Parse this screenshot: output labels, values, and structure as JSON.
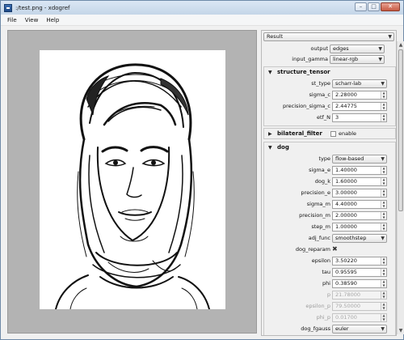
{
  "window": {
    "title": ":/test.png - xdogref"
  },
  "menu": [
    "File",
    "View",
    "Help"
  ],
  "result_combo": "Result",
  "top_fields": [
    {
      "label": "output",
      "value": "edges"
    },
    {
      "label": "input_gamma",
      "value": "linear-rgb"
    }
  ],
  "structure_tensor": {
    "title": "structure_tensor",
    "rows": [
      {
        "label": "st_type",
        "value": "scharr-lab",
        "kind": "combo"
      },
      {
        "label": "sigma_c",
        "value": "2.28000",
        "kind": "spin"
      },
      {
        "label": "precision_sigma_c",
        "value": "2.44775",
        "kind": "spin"
      },
      {
        "label": "etf_N",
        "value": "3",
        "kind": "spin"
      }
    ]
  },
  "bilateral_filter": {
    "title": "bilateral_filter",
    "enable_label": "enable"
  },
  "dog": {
    "title": "dog",
    "rows": [
      {
        "label": "type",
        "value": "flow-based",
        "kind": "combo"
      },
      {
        "label": "sigma_e",
        "value": "1.40000",
        "kind": "spin"
      },
      {
        "label": "dog_k",
        "value": "1.60000",
        "kind": "spin"
      },
      {
        "label": "precision_e",
        "value": "3.00000",
        "kind": "spin"
      },
      {
        "label": "sigma_m",
        "value": "4.40000",
        "kind": "spin"
      },
      {
        "label": "precision_m",
        "value": "2.00000",
        "kind": "spin"
      },
      {
        "label": "step_m",
        "value": "1.00000",
        "kind": "spin"
      },
      {
        "label": "adj_func",
        "value": "smoothstep",
        "kind": "combo"
      },
      {
        "label": "dog_reparam",
        "value": "✖",
        "kind": "cross"
      },
      {
        "label": "epsilon",
        "value": "3.50220",
        "kind": "spin"
      },
      {
        "label": "tau",
        "value": "0.95595",
        "kind": "spin"
      },
      {
        "label": "phi",
        "value": "0.38590",
        "kind": "spin"
      },
      {
        "label": "p",
        "value": "21.78000",
        "kind": "spin",
        "disabled": true
      },
      {
        "label": "epsilon_p",
        "value": "79.50000",
        "kind": "spin",
        "disabled": true
      },
      {
        "label": "phi_p",
        "value": "0.01700",
        "kind": "spin",
        "disabled": true
      },
      {
        "label": "dog_fgauss",
        "value": "euler",
        "kind": "combo"
      }
    ]
  },
  "icons": {
    "window_minimize": "minimize-icon",
    "window_maximize": "maximize-icon",
    "window_close": "close-icon",
    "section_expanded": "triangle-down-icon",
    "section_collapsed": "triangle-right-icon"
  },
  "colors": {
    "titlebar": "#c4d5e8",
    "viewport_bg": "#b3b3b3",
    "panel_bg": "#f0f0f0"
  }
}
